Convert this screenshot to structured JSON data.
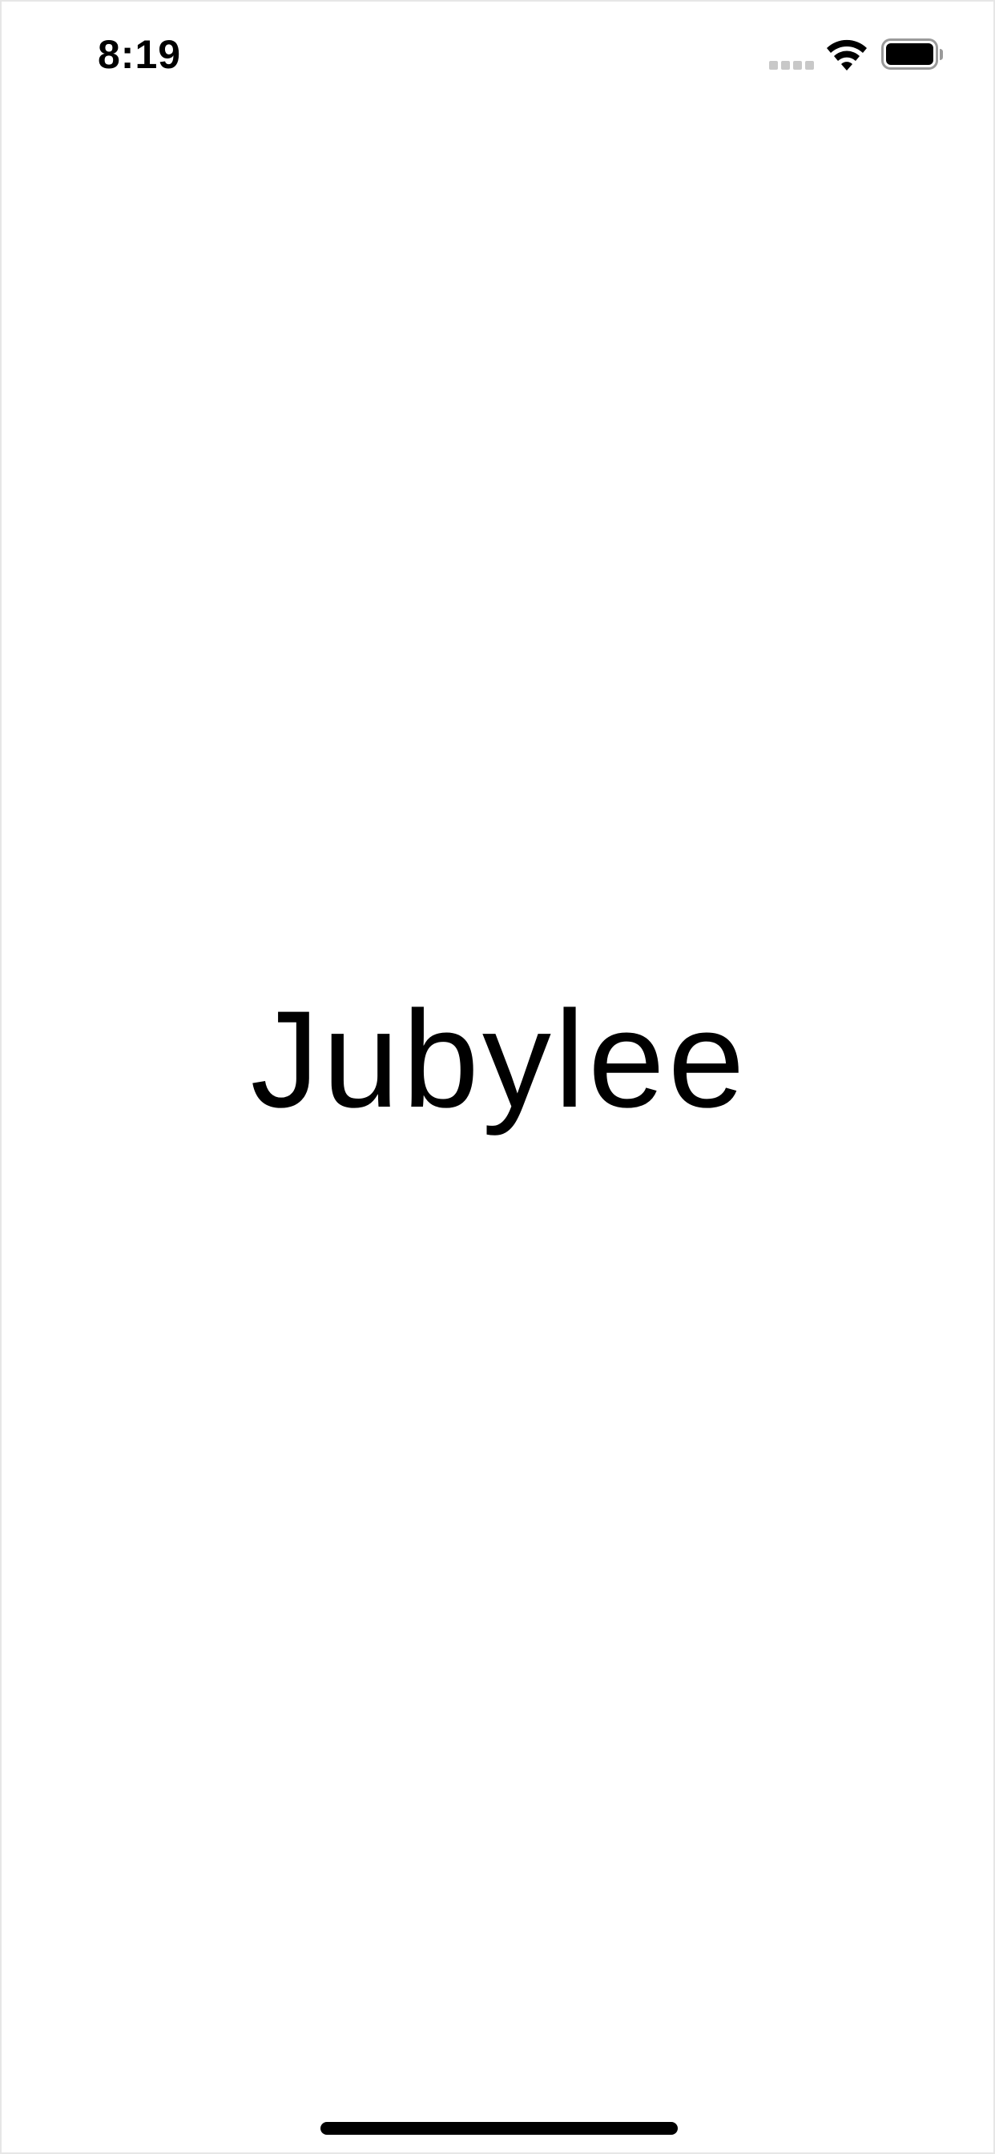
{
  "status_bar": {
    "time": "8:19",
    "icons": [
      "cellular-signal-icon",
      "wifi-icon",
      "battery-icon"
    ]
  },
  "main": {
    "title": "Jubylee"
  },
  "colors": {
    "background": "#ffffff",
    "text": "#000000",
    "signal_inactive": "#c8c8c8"
  }
}
